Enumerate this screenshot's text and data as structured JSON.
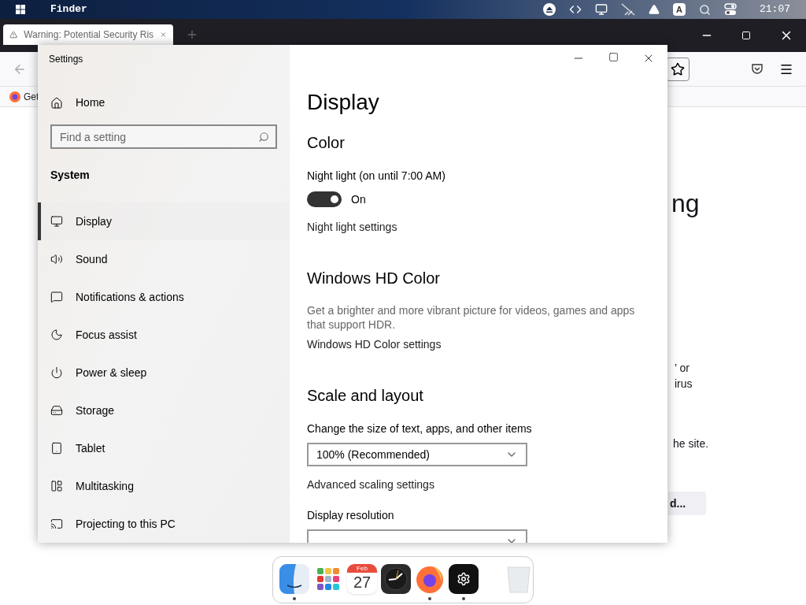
{
  "top_bar": {
    "app": "Finder",
    "tray_letter": "A",
    "time": "21:07"
  },
  "browser": {
    "tab": {
      "title": "Warning: Potential Security Ris",
      "selected": true
    },
    "bookmark": "Get",
    "page_fragments": {
      "heading": "ng",
      "lines": [
        "’ or",
        "irus"
      ],
      "line_2": "he site.",
      "button": "d..."
    }
  },
  "settings": {
    "title": "Settings",
    "home": "Home",
    "search": {
      "placeholder": "Find a setting"
    },
    "section": "System",
    "nav": [
      {
        "label": "Display",
        "selected": true
      },
      {
        "label": "Sound",
        "selected": false
      },
      {
        "label": "Notifications & actions",
        "selected": false
      },
      {
        "label": "Focus assist",
        "selected": false
      },
      {
        "label": "Power & sleep",
        "selected": false
      },
      {
        "label": "Storage",
        "selected": false
      },
      {
        "label": "Tablet",
        "selected": false
      },
      {
        "label": "Multitasking",
        "selected": false
      },
      {
        "label": "Projecting to this PC",
        "selected": false
      }
    ],
    "page": {
      "title": "Display",
      "sections": [
        {
          "heading": "Color",
          "items": [
            {
              "kind": "label",
              "text": "Night light (on until 7:00 AM)"
            },
            {
              "kind": "toggle",
              "on": true,
              "text": "On"
            },
            {
              "kind": "link",
              "text": "Night light settings"
            }
          ]
        },
        {
          "heading": "Windows HD Color",
          "items": [
            {
              "kind": "text",
              "text": "Get a brighter and more vibrant picture for videos, games and apps that support HDR."
            },
            {
              "kind": "link",
              "text": "Windows HD Color settings"
            }
          ]
        },
        {
          "heading": "Scale and layout",
          "items": [
            {
              "kind": "label",
              "text": "Change the size of text, apps, and other items"
            },
            {
              "kind": "dropdown",
              "text": "100% (Recommended)"
            },
            {
              "kind": "link",
              "text": "Advanced scaling settings"
            },
            {
              "kind": "label",
              "text": "Display resolution"
            },
            {
              "kind": "dropdown"
            }
          ]
        }
      ]
    }
  },
  "dock": {
    "items": [
      {
        "kind": "finder",
        "running": true
      },
      {
        "kind": "launchpad",
        "running": false
      },
      {
        "kind": "calendar",
        "month": "Feb",
        "day": "27",
        "running": false
      },
      {
        "kind": "clock",
        "running": false
      },
      {
        "kind": "firefox",
        "running": true
      },
      {
        "kind": "settings",
        "running": true
      },
      {
        "kind": "trash",
        "running": false
      }
    ]
  }
}
